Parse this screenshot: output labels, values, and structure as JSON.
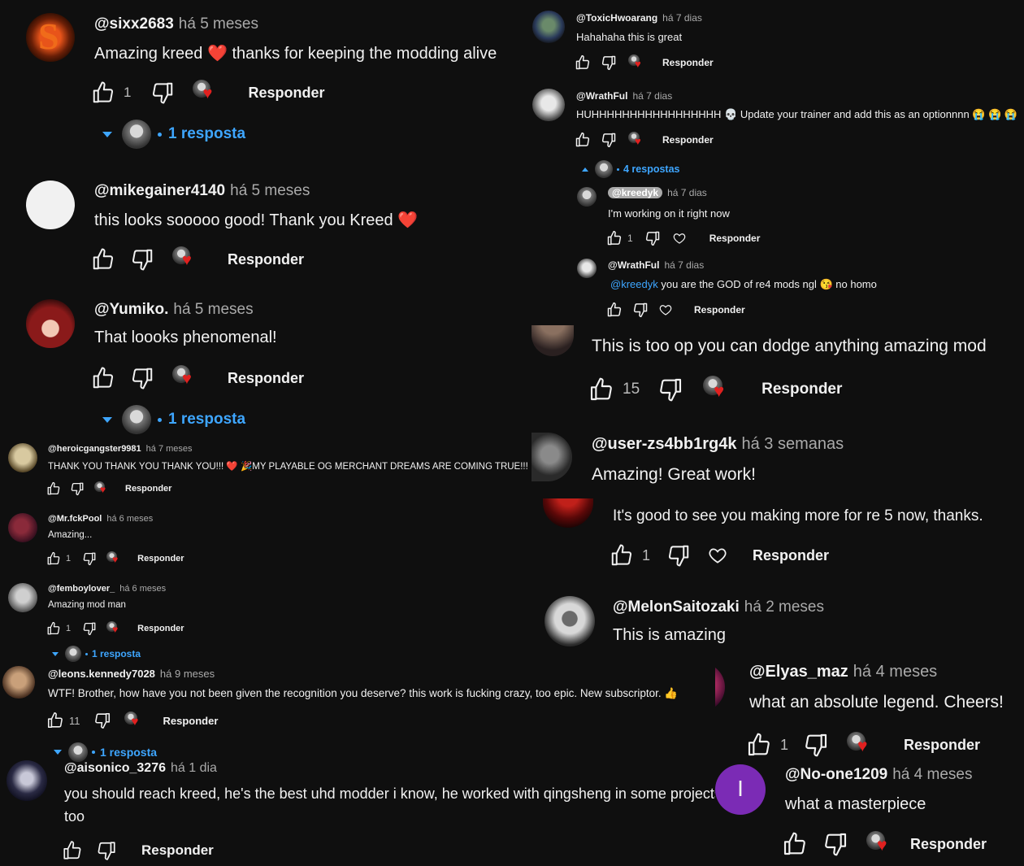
{
  "common": {
    "reply_label": "Responder",
    "unit_hint": ""
  },
  "comments": [
    {
      "user": "@sixx2683",
      "time": "há 5 meses",
      "text": "Amazing kreed",
      "text2": "thanks for keeping the modding alive",
      "likes": "1",
      "replies": "1 resposta"
    },
    {
      "user": "@mikegainer4140",
      "time": "há 5 meses",
      "text": "this looks sooooo good! Thank you Kreed"
    },
    {
      "user": "@Yumiko.",
      "time": "há 5 meses",
      "text": "That loooks phenomenal!",
      "replies": "1 resposta"
    },
    {
      "user": "@heroicgangster9981",
      "time": "há 7 meses",
      "text": "THANK YOU THANK YOU THANK YOU!!!",
      "text2": "MY PLAYABLE OG MERCHANT DREAMS ARE COMING TRUE!!!"
    },
    {
      "user": "@Mr.fckPool",
      "time": "há 6 meses",
      "text": "Amazing...",
      "likes": "1"
    },
    {
      "user": "@femboylover_",
      "time": "há 6 meses",
      "text": "Amazing mod man",
      "likes": "1",
      "replies": "1 resposta"
    },
    {
      "user": "@leons.kennedy7028",
      "time": "há 9 meses",
      "text": "WTF! Brother, how have you not been given the recognition you deserve? this work is fucking crazy, too epic. New subscriptor.",
      "likes": "11",
      "replies": "1 resposta"
    },
    {
      "user": "@aisonico_3276",
      "time": "há 1 dia",
      "text": "you should reach kreed, he's the best uhd modder i know, he worked with qingsheng in some projects",
      "text2": "too"
    },
    {
      "user": "@ToxicHwoarang",
      "time": "há 7 dias",
      "text": "Hahahaha this is great"
    },
    {
      "user": "@WrathFul",
      "time": "há 7 dias",
      "text": "HUHHHHHHHHHHHHHHHHH",
      "text2": "Update your trainer and add this as an optionnnn",
      "replies": "4 respostas"
    },
    {
      "user": "@kreedyk",
      "time": "há 7 dias",
      "text": "I'm working on it right now",
      "likes": "1"
    },
    {
      "user": "@WrathFul",
      "time": "há 7 dias",
      "mention": "@kreedyk",
      "text": "you are the GOD of re4 mods ngl",
      "text2": "no homo"
    },
    {
      "user": "",
      "time": "",
      "text": "This is too op you can dodge anything amazing mod",
      "likes": "15"
    },
    {
      "user": "@user-zs4bb1rg4k",
      "time": "há 3 semanas",
      "text": "Amazing! Great work!"
    },
    {
      "user": "",
      "time": "",
      "text": "It's good to see you making more for re 5 now, thanks.",
      "likes": "1"
    },
    {
      "user": "@MelonSaitozaki",
      "time": "há 2 meses",
      "text": "This is amazing"
    },
    {
      "user": "@Elyas_maz",
      "time": "há 4 meses",
      "text": "what an absolute legend. Cheers!",
      "likes": "1"
    },
    {
      "user": "@No-one1209",
      "time": "há 4 meses",
      "text": "what a masterpiece",
      "avatar_letter": "I"
    }
  ],
  "colors": {
    "background": "#0f0f0f",
    "link": "#3ea6ff",
    "heart": "#e0201f",
    "avatar_purple": "#7b2bb5"
  },
  "icons": [
    "thumb-up-icon",
    "thumb-down-icon",
    "creator-heart-icon",
    "heart-outline-icon",
    "chevron-down-icon",
    "chevron-up-icon"
  ]
}
